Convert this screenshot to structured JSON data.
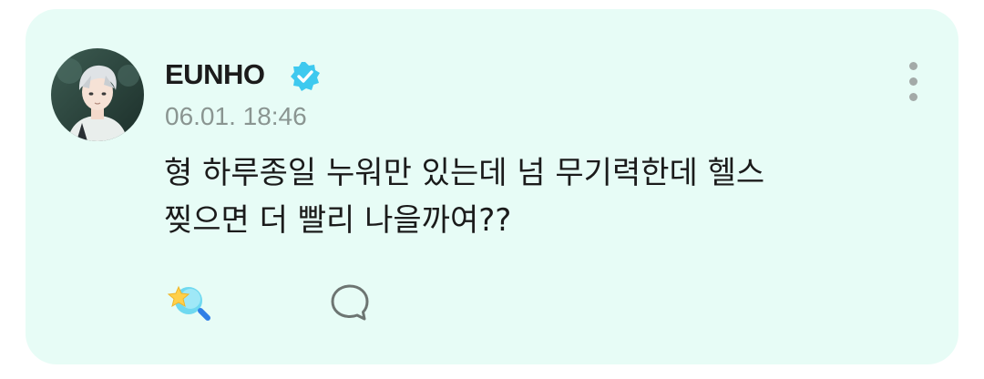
{
  "post": {
    "author": {
      "name": "EUNHO",
      "verified_icon": "verified-badge-icon",
      "avatar": "profile-avatar"
    },
    "timestamp": "06.01. 18:46",
    "text_lines": [
      "형 하루종일 누워만 있는데 넘 무기력한데 헬스",
      "찢으면 더 빨리 나을까여??"
    ],
    "actions": {
      "reaction_icon": "star-bubble-icon",
      "comment_icon": "comment-bubble-icon",
      "more_icon": "more-vertical-icon"
    }
  },
  "colors": {
    "card_background": "#e7fcf6",
    "verified": "#3ec9ef",
    "text": "#1b1b1b",
    "muted": "#8a9591"
  }
}
